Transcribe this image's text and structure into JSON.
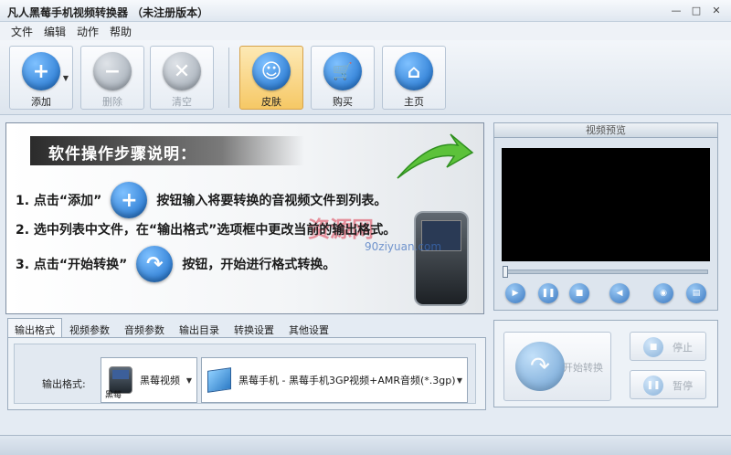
{
  "window": {
    "title": "凡人黑莓手机视频转换器  （未注册版本）",
    "buttons": {
      "minimize": "—",
      "maximize": "□",
      "close": "✕"
    }
  },
  "menu": [
    "文件",
    "编辑",
    "动作",
    "帮助"
  ],
  "toolbar": {
    "add": "添加",
    "delete": "删除",
    "clear": "清空",
    "skin": "皮肤",
    "buy": "购买",
    "home": "主页"
  },
  "instructions": {
    "heading": "软件操作步骤说明：",
    "step1_before": "1. 点击“添加”",
    "step1_after": "按钮输入将要转换的音视频文件到列表。",
    "step2": "2. 选中列表中文件，在“输出格式”选项框中更改当前的输出格式。",
    "step3_before": "3. 点击“开始转换”",
    "step3_after": "按钮，开始进行格式转换。",
    "watermark": "资源网",
    "watermark_url": "90ziyuan.com"
  },
  "preview": {
    "title": "视频预览"
  },
  "tabs": [
    "输出格式",
    "视频参数",
    "音频参数",
    "输出目录",
    "转换设置",
    "其他设置"
  ],
  "output": {
    "label": "输出格式:",
    "device_value": "黑莓视频",
    "device_caption": "黑莓",
    "format_value": "黑莓手机 - 黑莓手机3GP视频+AMR音频(*.3gp)"
  },
  "convert": {
    "start": "开始转换",
    "stop": "停止",
    "pause": "暂停"
  },
  "colors": {
    "accent": "#1569c7",
    "active_button": "#f6c865",
    "watermark": "#dc3c50"
  }
}
